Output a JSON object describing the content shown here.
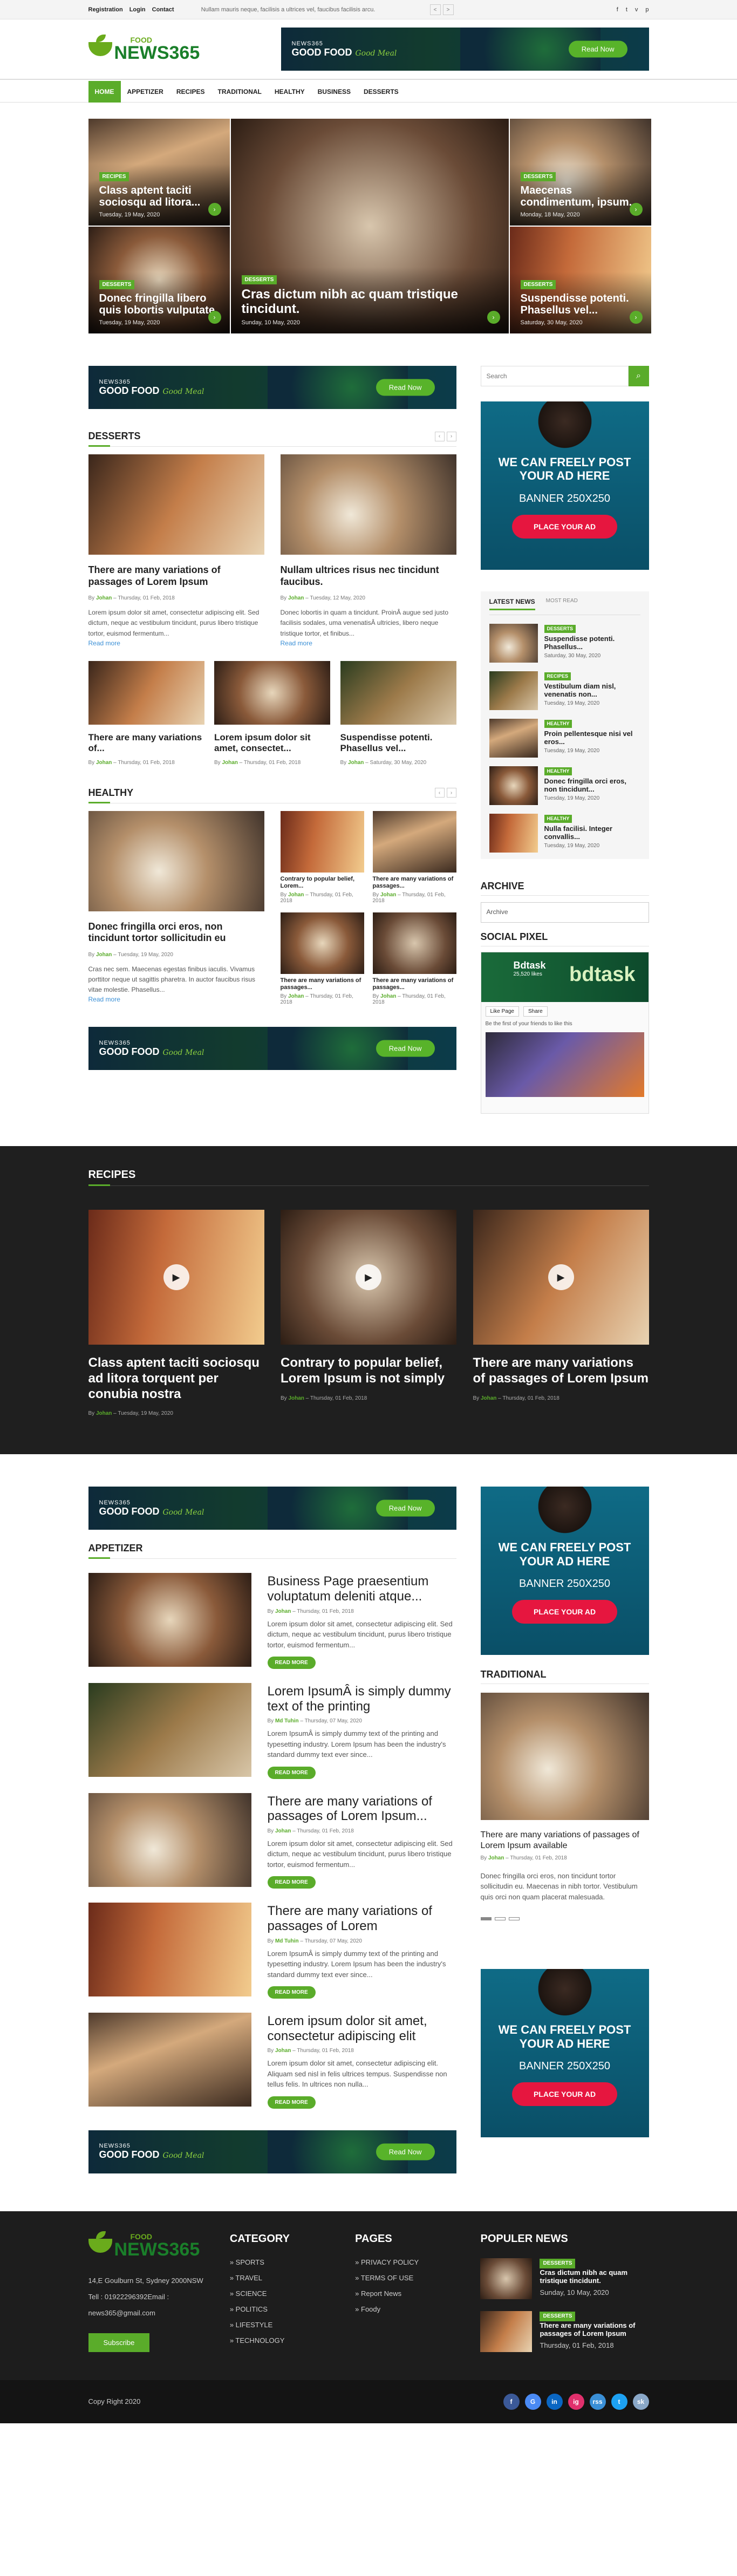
{
  "topbar": {
    "links": [
      "Registration",
      "Login",
      "Contact"
    ],
    "ticker": "Nullam mauris neque, facilisis a ultrices vel, faucibus facilisis arcu.",
    "social": [
      "f",
      "t",
      "v",
      "p"
    ],
    "prev": "<",
    "next": ">"
  },
  "logo": {
    "food": "FOOD",
    "news": "NEWS365"
  },
  "banner": {
    "line1": "NEWS365",
    "line2": "GOOD FOOD",
    "script": "Good Meal",
    "button": "Read Now"
  },
  "nav": [
    "Home",
    "Appetizer",
    "Recipes",
    "Traditional",
    "Healthy",
    "Business",
    "Desserts"
  ],
  "hero": [
    {
      "tag": "RECIPES",
      "title": "Class aptent taciti sociosqu ad litora...",
      "date": "Tuesday, 19 May, 2020"
    },
    {
      "tag": "DESSERTS",
      "title": "Maecenas condimentum, ipsum...",
      "date": "Monday, 18 May, 2020"
    },
    {
      "tag": "DESSERTS",
      "title": "Cras dictum nibh ac quam tristique tincidunt.",
      "date": "Sunday, 10 May, 2020"
    },
    {
      "tag": "DESSERTS",
      "title": "Donec fringilla libero quis lobortis vulputate.",
      "date": "Tuesday, 19 May, 2020"
    },
    {
      "tag": "DESSERTS",
      "title": "Suspendisse potenti. Phasellus vel...",
      "date": "Saturday, 30 May, 2020"
    }
  ],
  "desserts": {
    "title": "DESSERTS",
    "big": [
      {
        "title": "There are many variations of passages of Lorem Ipsum",
        "author": "Johan",
        "date": "Thursday, 01 Feb, 2018",
        "text": "Lorem ipsum dolor sit amet, consectetur adipiscing elit. Sed dictum, neque ac vestibulum tincidunt, purus libero tristique tortor, euismod fermentum...",
        "more": "Read more"
      },
      {
        "title": "Nullam ultrices risus nec tincidunt faucibus.",
        "author": "Johan",
        "date": "Tuesday, 12 May, 2020",
        "text": "Donec lobortis in quam a tincidunt. ProinÂ augue sed justo facilisis sodales, uma venenatisÂ ultricies, libero neque tristique tortor, et finibus...",
        "more": "Read more"
      }
    ],
    "small": [
      {
        "title": "There are many variations of...",
        "author": "Johan",
        "date": "Thursday, 01 Feb, 2018"
      },
      {
        "title": "Lorem ipsum dolor sit amet, consectet...",
        "author": "Johan",
        "date": "Thursday, 01 Feb, 2018"
      },
      {
        "title": "Suspendisse potenti. Phasellus vel...",
        "author": "Johan",
        "date": "Saturday, 30 May, 2020"
      }
    ]
  },
  "healthy": {
    "title": "HEALTHY",
    "big": {
      "title": "Donec fringilla orci eros, non tincidunt tortor sollicitudin eu",
      "author": "Johan",
      "date": "Tuesday, 19 May, 2020",
      "text": "Cras nec sem. Maecenas egestas finibus iaculis. Vivamus porttitor neque ut sagittis pharetra. In auctor faucibus risus vitae molestie. Phasellus...",
      "more": "Read more"
    },
    "small": [
      {
        "title": "Contrary to popular belief, Lorem...",
        "author": "Johan",
        "date": "Thursday, 01 Feb, 2018"
      },
      {
        "title": "There are many variations of passages...",
        "author": "Johan",
        "date": "Thursday, 01 Feb, 2018"
      },
      {
        "title": "There are many variations of passages...",
        "author": "Johan",
        "date": "Thursday, 01 Feb, 2018"
      },
      {
        "title": "There are many variations of passages...",
        "author": "Johan",
        "date": "Thursday, 01 Feb, 2018"
      }
    ]
  },
  "sidebar": {
    "search_placeholder": "Search",
    "search_icon": "search-icon",
    "ad": {
      "line1": "WE CAN FREELY POST YOUR AD HERE",
      "line2": "BANNER 250X250",
      "button": "PLACE YOUR AD"
    },
    "tabs": [
      "LATEST NEWS",
      "MOST READ"
    ],
    "latest": [
      {
        "tag": "DESSERTS",
        "title": "Suspendisse potenti. Phasellus...",
        "date": "Saturday, 30 May, 2020"
      },
      {
        "tag": "RECIPES",
        "title": "Vestibulum diam nisl, venenatis non...",
        "date": "Tuesday, 19 May, 2020"
      },
      {
        "tag": "HEALTHY",
        "title": "Proin pellentesque nisi vel eros...",
        "date": "Tuesday, 19 May, 2020"
      },
      {
        "tag": "HEALTHY",
        "title": "Donec fringilla orci eros, non tincidunt...",
        "date": "Tuesday, 19 May, 2020"
      },
      {
        "tag": "HEALTHY",
        "title": "Nulla facilisi. Integer convallis...",
        "date": "Tuesday, 19 May, 2020"
      }
    ],
    "archive": "ARCHIVE",
    "archive_select": "Archive",
    "social": "SOCIAL PIXEL",
    "fb": {
      "name": "Bdtask",
      "likes": "25,520 likes",
      "brand": "bdtask",
      "like": "Like Page",
      "share": "Share",
      "friends": "Be the first of your friends to like this"
    }
  },
  "recipes": {
    "title": "RECIPES",
    "items": [
      {
        "title": "Class aptent taciti sociosqu ad litora torquent per conubia nostra",
        "author": "Johan",
        "date": "Tuesday, 19 May, 2020"
      },
      {
        "title": "Contrary to popular belief, Lorem Ipsum is not simply",
        "author": "Johan",
        "date": "Thursday, 01 Feb, 2018"
      },
      {
        "title": "There are many variations of passages of Lorem Ipsum",
        "author": "Johan",
        "date": "Thursday, 01 Feb, 2018"
      }
    ]
  },
  "appetizer": {
    "title": "APPETIZER",
    "items": [
      {
        "title": "Business Page praesentium voluptatum deleniti atque...",
        "author": "Johan",
        "date": "Thursday, 01 Feb, 2018",
        "text": "Lorem ipsum dolor sit amet, consectetur adipiscing elit. Sed dictum, neque ac vestibulum tincidunt, purus libero tristique tortor, euismod fermentum..."
      },
      {
        "title": "Lorem IpsumÂ is simply dummy text of the printing",
        "author": "Md Tuhin",
        "date": "Thursday, 07 May, 2020",
        "text": "Lorem IpsumÂ is simply dummy text of the printing and typesetting industry. Lorem Ipsum has been the industry's standard dummy text ever since..."
      },
      {
        "title": "There are many variations of passages of Lorem Ipsum...",
        "author": "Johan",
        "date": "Thursday, 01 Feb, 2018",
        "text": "Lorem ipsum dolor sit amet, consectetur adipiscing elit. Sed dictum, neque ac vestibulum tincidunt, purus libero tristique tortor, euismod fermentum..."
      },
      {
        "title": "There are many variations of passages of Lorem",
        "author": "Md Tuhin",
        "date": "Thursday, 07 May, 2020",
        "text": "Lorem IpsumÂ is simply dummy text of the printing and typesetting industry. Lorem Ipsum has been the industry's standard dummy text ever since..."
      },
      {
        "title": "Lorem ipsum dolor sit amet, consectetur adipiscing elit",
        "author": "Johan",
        "date": "Thursday, 01 Feb, 2018",
        "text": "Lorem ipsum dolor sit amet, consectetur adipiscing elit. Aliquam sed nisl in felis ultrices tempus. Suspendisse non tellus felis. In ultrices non nulla..."
      }
    ],
    "more": "READ MORE"
  },
  "traditional": {
    "title": "TRADITIONAL",
    "item": {
      "title": "There are many variations of passages of Lorem Ipsum available",
      "author": "Johan",
      "date": "Thursday, 01 Feb, 2018",
      "text": "Donec fringilla orci eros, non tincidunt tortor sollicitudin eu. Maecenas in nibh tortor. Vestibulum quis orci non quam placerat malesuada."
    }
  },
  "footer": {
    "address": "14,E Goulburn St, Sydney 2000NSW",
    "tel": "Tell : 01922296392Email :",
    "email": "news365@gmail.com",
    "subscribe": "Subscribe",
    "category_title": "CATEGORY",
    "categories": [
      "» SPORTS",
      "» TRAVEL",
      "» SCIENCE",
      "» POLITICS",
      "» LIFESTYLE",
      "» TECHNOLOGY"
    ],
    "pages_title": "PAGES",
    "pages": [
      "» PRIVACY POLICY",
      "» TERMS OF USE",
      "» Report News",
      "» Foody"
    ],
    "popular_title": "POPULER NEWS",
    "popular": [
      {
        "tag": "DESSERTS",
        "title": "Cras dictum nibh ac quam tristique tincidunt.",
        "date": "Sunday, 10 May, 2020"
      },
      {
        "tag": "DESSERTS",
        "title": "There are many variations of passages of Lorem Ipsum",
        "date": "Thursday, 01 Feb, 2018"
      }
    ],
    "copyright": "Copy Right 2020",
    "social": [
      {
        "l": "f",
        "c": "#3b5998"
      },
      {
        "l": "G",
        "c": "#4a8af4"
      },
      {
        "l": "in",
        "c": "#0a66c2"
      },
      {
        "l": "ig",
        "c": "#e1306c"
      },
      {
        "l": "rss",
        "c": "#3a8fd6"
      },
      {
        "l": "t",
        "c": "#1da1f2"
      },
      {
        "l": "sk",
        "c": "#8aa8c8"
      }
    ]
  }
}
